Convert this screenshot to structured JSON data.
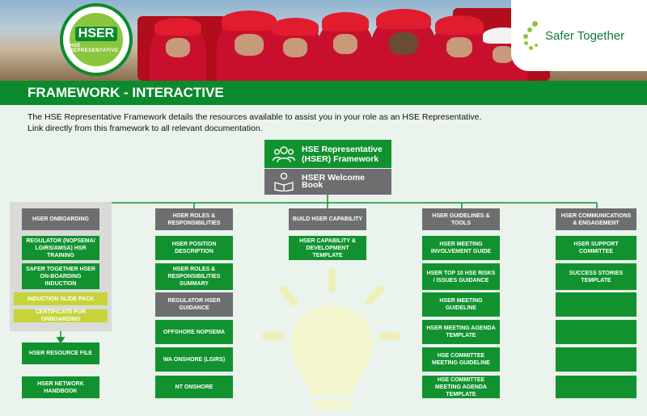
{
  "header": {
    "badge_line1": "HSER",
    "badge_line2": "HSE REPRESENTATIVE",
    "logo_text": "Safer Together"
  },
  "title": "FRAMEWORK - INTERACTIVE",
  "intro_line1": "The HSE Representative Framework details the resources available to assist you in your role as an HSE Representative.",
  "intro_line2": "Link directly from this framework to all relevant documentation.",
  "root": {
    "framework": "HSE Representative (HSER) Framework",
    "welcome": "HSER Welcome Book"
  },
  "columns": [
    {
      "header": "HSER ONBOARDING",
      "items": [
        "REGULATOR (NOPSEMA/ LGIRS/AMSA) HSR TRAINING",
        "SAFER TOGETHER HSER ON-BOARDING INDUCTION",
        "INDUCTION SLIDE PACK",
        "CERTIFICATE FOR ONBOARDING",
        "HSER RESOURCE FILE",
        "HSER NETWORK HANDBOOK"
      ]
    },
    {
      "header": "HSER ROLES & RESPONSIBILITIES",
      "items": [
        "HSER POSITION DESCRIPTION",
        "HSER ROLES & RESPONSIBILITIES SUMMARY",
        "REGULATOR HSER GUIDANCE",
        "OFFSHORE NOPSEMA",
        "WA ONSHORE (LGIRS)",
        "NT ONSHORE"
      ]
    },
    {
      "header": "BUILD HSER CAPABILITY",
      "items": [
        "HSER CAPABILITY & DEVELOPMENT TEMPLATE"
      ]
    },
    {
      "header": "HSER GUIDELINES & TOOLS",
      "items": [
        "HSER MEETING INVOLVEMENT GUIDE",
        "HSER TOP 10 HSE RISKS / ISSUES GUIDANCE",
        "HSER MEETING GUIDELINE",
        "HSER MEETING AGENDA TEMPLATE",
        "HSE COMMITTEE MEETING GUIDELINE",
        "HSE COMMITTEE MEETING AGENDA TEMPLATE"
      ]
    },
    {
      "header": "HSER COMMUNICATIONS & ENGAGEMENT",
      "items": [
        "HSER SUPPORT COMMITTEE",
        "SUCCESS STORIES TEMPLATE"
      ]
    }
  ],
  "colors": {
    "green": "#11922f",
    "dark_green": "#0c8a2e",
    "grey": "#6d6e70",
    "lime": "#c6d43a",
    "background": "#eaf3ec"
  }
}
